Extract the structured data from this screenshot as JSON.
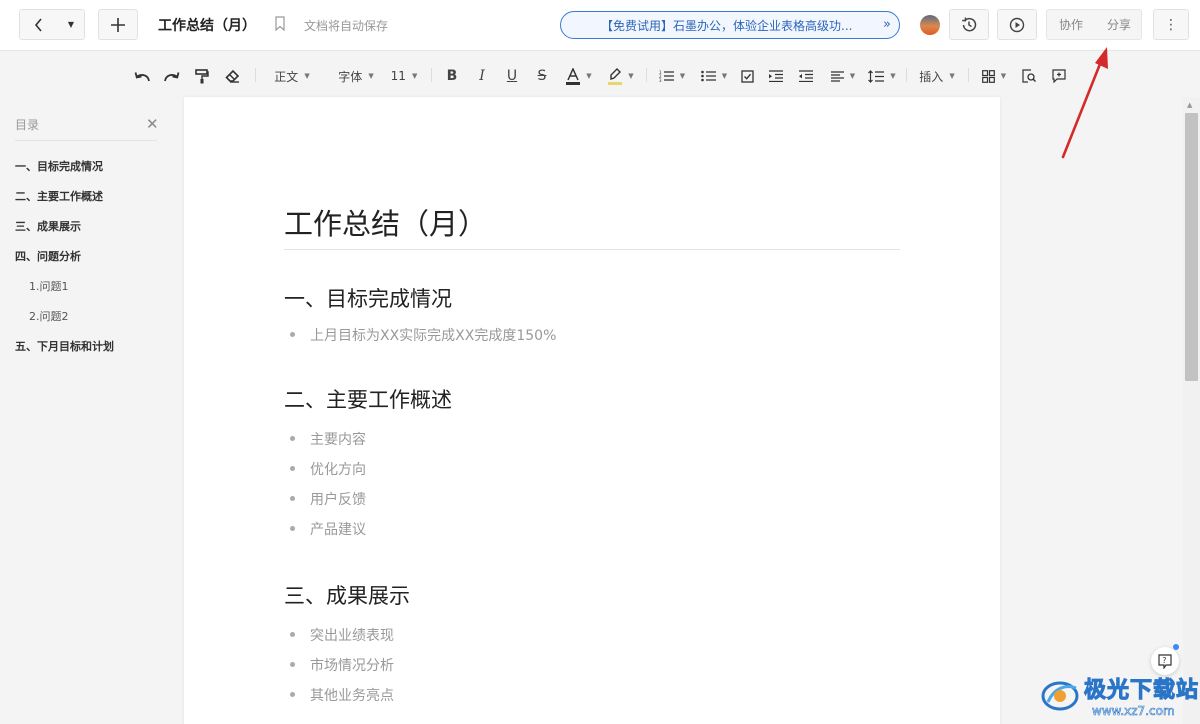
{
  "header": {
    "doc_title": "工作总结（月）",
    "autosave_text": "文档将自动保存",
    "promo_text": "【免费试用】石墨办公，体验企业表格高级功...",
    "collaborate_label": "协作",
    "share_label": "分享",
    "more_label": "⋮"
  },
  "toolbar": {
    "style_label": "正文",
    "font_label": "字体",
    "size_label": "11",
    "insert_label": "插入"
  },
  "outline": {
    "title": "目录",
    "items": [
      {
        "label": "一、目标完成情况",
        "level": 1
      },
      {
        "label": "二、主要工作概述",
        "level": 1
      },
      {
        "label": "三、成果展示",
        "level": 1
      },
      {
        "label": "四、问题分析",
        "level": 1
      },
      {
        "label": "1.问题1",
        "level": 2
      },
      {
        "label": "2.问题2",
        "level": 2
      },
      {
        "label": "五、下月目标和计划",
        "level": 1
      }
    ]
  },
  "document": {
    "title": "工作总结（月）",
    "sections": [
      {
        "heading": "一、目标完成情况",
        "bullets": [
          "上月目标为XX实际完成XX完成度150%"
        ]
      },
      {
        "heading": "二、主要工作概述",
        "bullets": [
          "主要内容",
          "优化方向",
          "用户反馈",
          "产品建议"
        ]
      },
      {
        "heading": "三、成果展示",
        "bullets": [
          "突出业绩表现",
          "市场情况分析",
          "其他业务亮点"
        ]
      }
    ]
  },
  "watermark": {
    "name": "极光下载站",
    "url": "www.xz7.com"
  },
  "colors": {
    "accent_blue": "#2c65b8",
    "annotation_arrow": "#d42a2a"
  }
}
